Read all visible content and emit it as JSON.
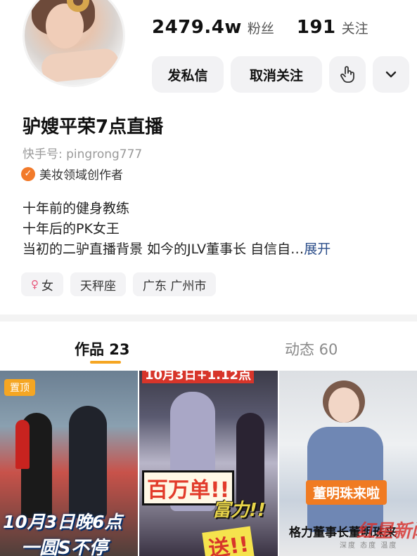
{
  "profile": {
    "followers_count": "2479.4w",
    "followers_label": "粉丝",
    "following_count": "191",
    "following_label": "关注",
    "nickname": "驴嫂平荣7点直播",
    "kuaishou_id": "快手号: pingrong777",
    "verification": "美妆领域创作者",
    "bio_lines": [
      "十年前的健身教练",
      "十年后的PK女王",
      "当初的二驴直播背景 如今的JLV董事长 自信自…"
    ],
    "bio_expand": "展开",
    "tags": {
      "gender": "女",
      "zodiac": "天秤座",
      "location": "广东 广州市"
    }
  },
  "actions": {
    "message_label": "发私信",
    "unfollow_label": "取消关注",
    "gesture_icon": "hand-tap-icon",
    "more_icon": "chevron-down-icon"
  },
  "tabs": {
    "works": "作品 23",
    "dynamics": "动态 60"
  },
  "videos": [
    {
      "pinned_label": "置顶",
      "overlay_line1": "10月3日晚6点",
      "overlay_line2": "一圆S不停"
    },
    {
      "top_banner": "10月3日+1.12点",
      "overlay_line1": "百万单!!",
      "overlay_line2": "富力!!",
      "overlay_line3": "送!!"
    },
    {
      "overlay_line1": "董明珠来啦",
      "overlay_line2": "格力董事长董明珠来",
      "watermark": "红星新闻",
      "watermark_sub": "深度 态度 温度"
    }
  ],
  "colors": {
    "accent_orange": "#f5a623",
    "verify_badge": "#f27a2a",
    "expand_link": "#2c4e8a",
    "gender_icon": "#e8567b"
  }
}
